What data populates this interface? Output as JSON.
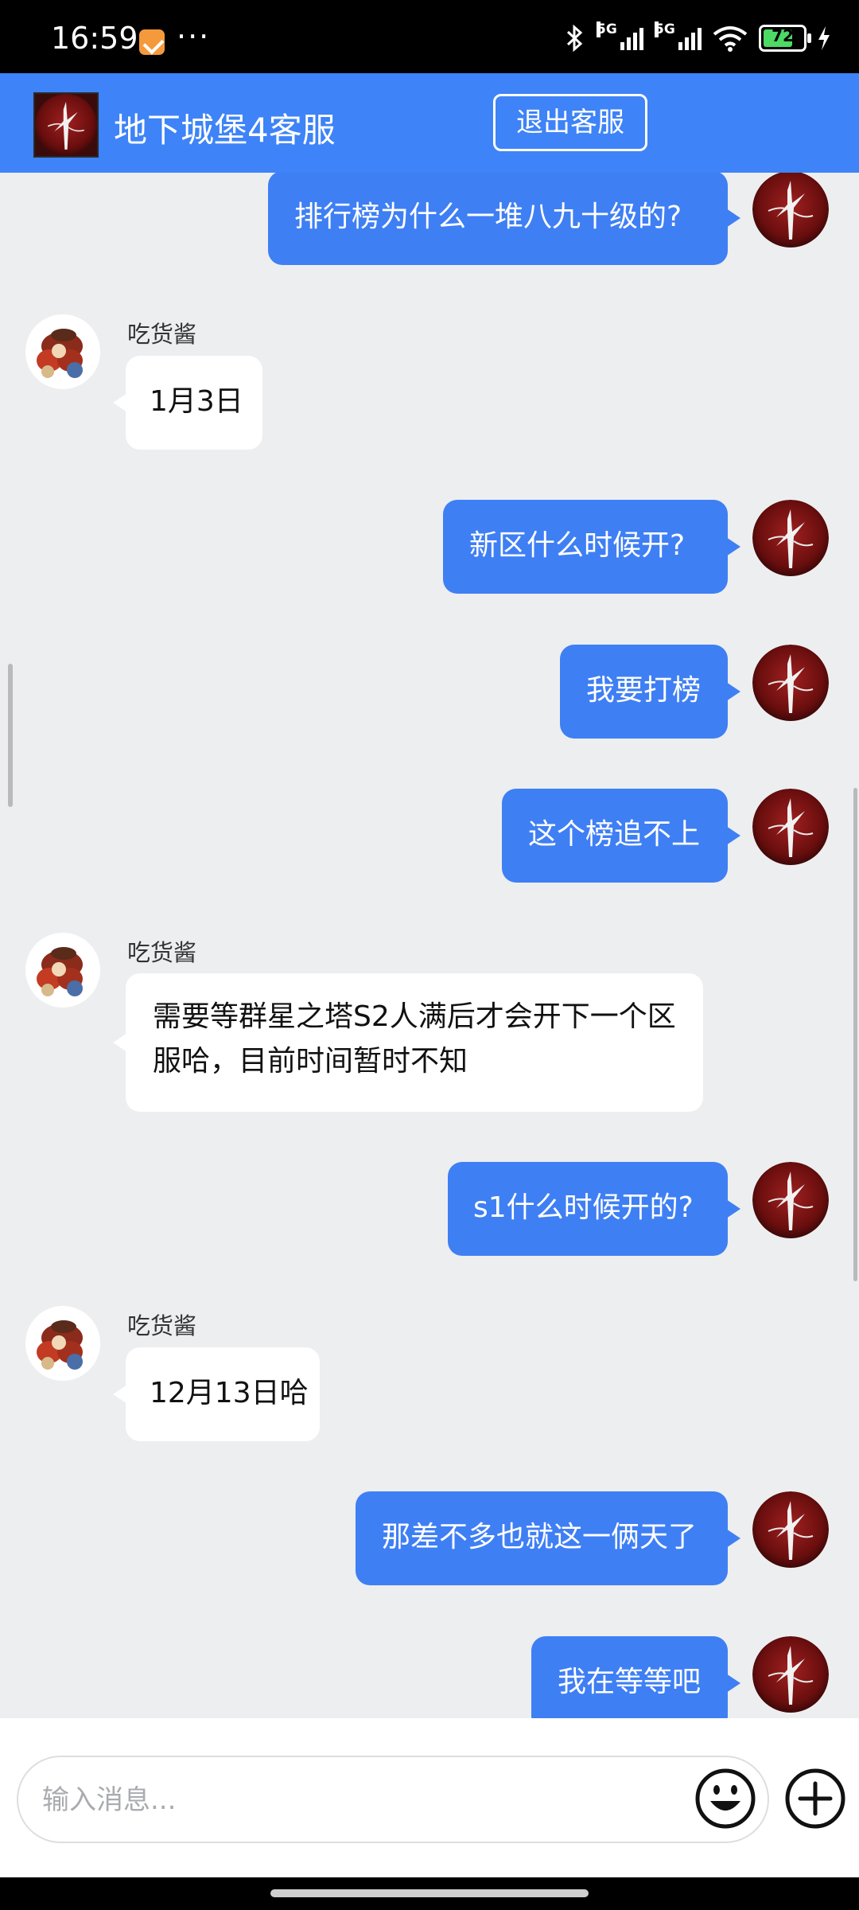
{
  "status_bar": {
    "time": "16:59",
    "dots": "···",
    "network1": "5G",
    "network2": "5G",
    "battery": "72",
    "icons": [
      "notes-app-icon",
      "bluetooth-icon",
      "signal-icon",
      "signal-icon",
      "wifi-icon",
      "battery-icon",
      "charging-icon"
    ]
  },
  "header": {
    "title": "地下城堡4客服",
    "exit_button": "退出客服"
  },
  "colors": {
    "header": "#3E83F7",
    "outgoing_bubble": "#3F7FF4",
    "incoming_bubble": "#FFFFFF",
    "background": "#EDEEF0"
  },
  "messages": [
    {
      "side": "out",
      "text": "排行榜为什么一堆八九十级的?"
    },
    {
      "side": "in",
      "sender": "吃货酱",
      "text": "1月3日"
    },
    {
      "side": "out",
      "text": "新区什么时候开?"
    },
    {
      "side": "out",
      "text": "我要打榜"
    },
    {
      "side": "out",
      "text": "这个榜追不上"
    },
    {
      "side": "in",
      "sender": "吃货酱",
      "text": "需要等群星之塔S2人满后才会开下一个区服哈，目前时间暂时不知"
    },
    {
      "side": "out",
      "text": "s1什么时候开的?"
    },
    {
      "side": "in",
      "sender": "吃货酱",
      "text": "12月13日哈"
    },
    {
      "side": "out",
      "text": "那差不多也就这一俩天了"
    },
    {
      "side": "out",
      "text": "我在等等吧"
    }
  ],
  "input": {
    "placeholder": "输入消息..."
  }
}
